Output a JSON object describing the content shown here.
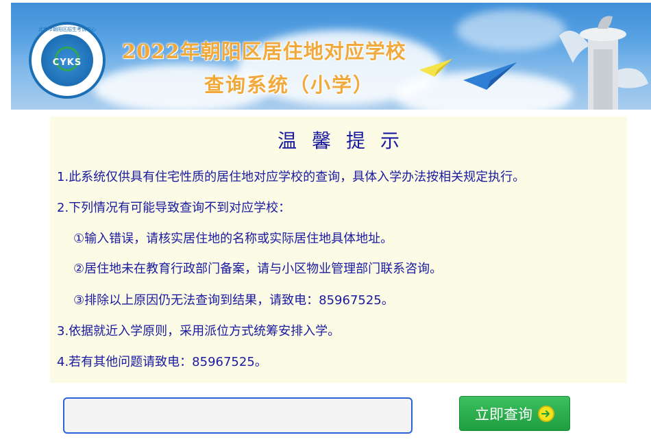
{
  "banner": {
    "title_line1": "2022年朝阳区居住地对应学校",
    "title_line2": "查询系统（小学）",
    "logo_text": "CYKS",
    "logo_ring_text": "北京市朝阳区招生考试中心"
  },
  "tips": {
    "heading": "温馨提示",
    "items": [
      "1.此系统仅供具有住宅性质的居住地对应学校的查询，具体入学办法按相关规定执行。",
      "2.下列情况有可能导致查询不到对应学校：",
      "①输入错误，请核实居住地的名称或实际居住地具体地址。",
      "②居住地未在教育行政部门备案，请与小区物业管理部门联系咨询。",
      "③排除以上原因仍无法查询到结果，请致电：85967525。",
      "3.依据就近入学原则，采用派位方式统筹安排入学。",
      "4.若有其他问题请致电：85967525。"
    ]
  },
  "search": {
    "value": "",
    "placeholder": "",
    "button_label": "立即查询",
    "button_icon": "arrow-right-circle-icon"
  },
  "colors": {
    "text_blue": "#1a1aa0",
    "tips_bg": "#fcfbe5",
    "button_green": "#1f9e3e",
    "title_orange": "#f2a93b"
  }
}
